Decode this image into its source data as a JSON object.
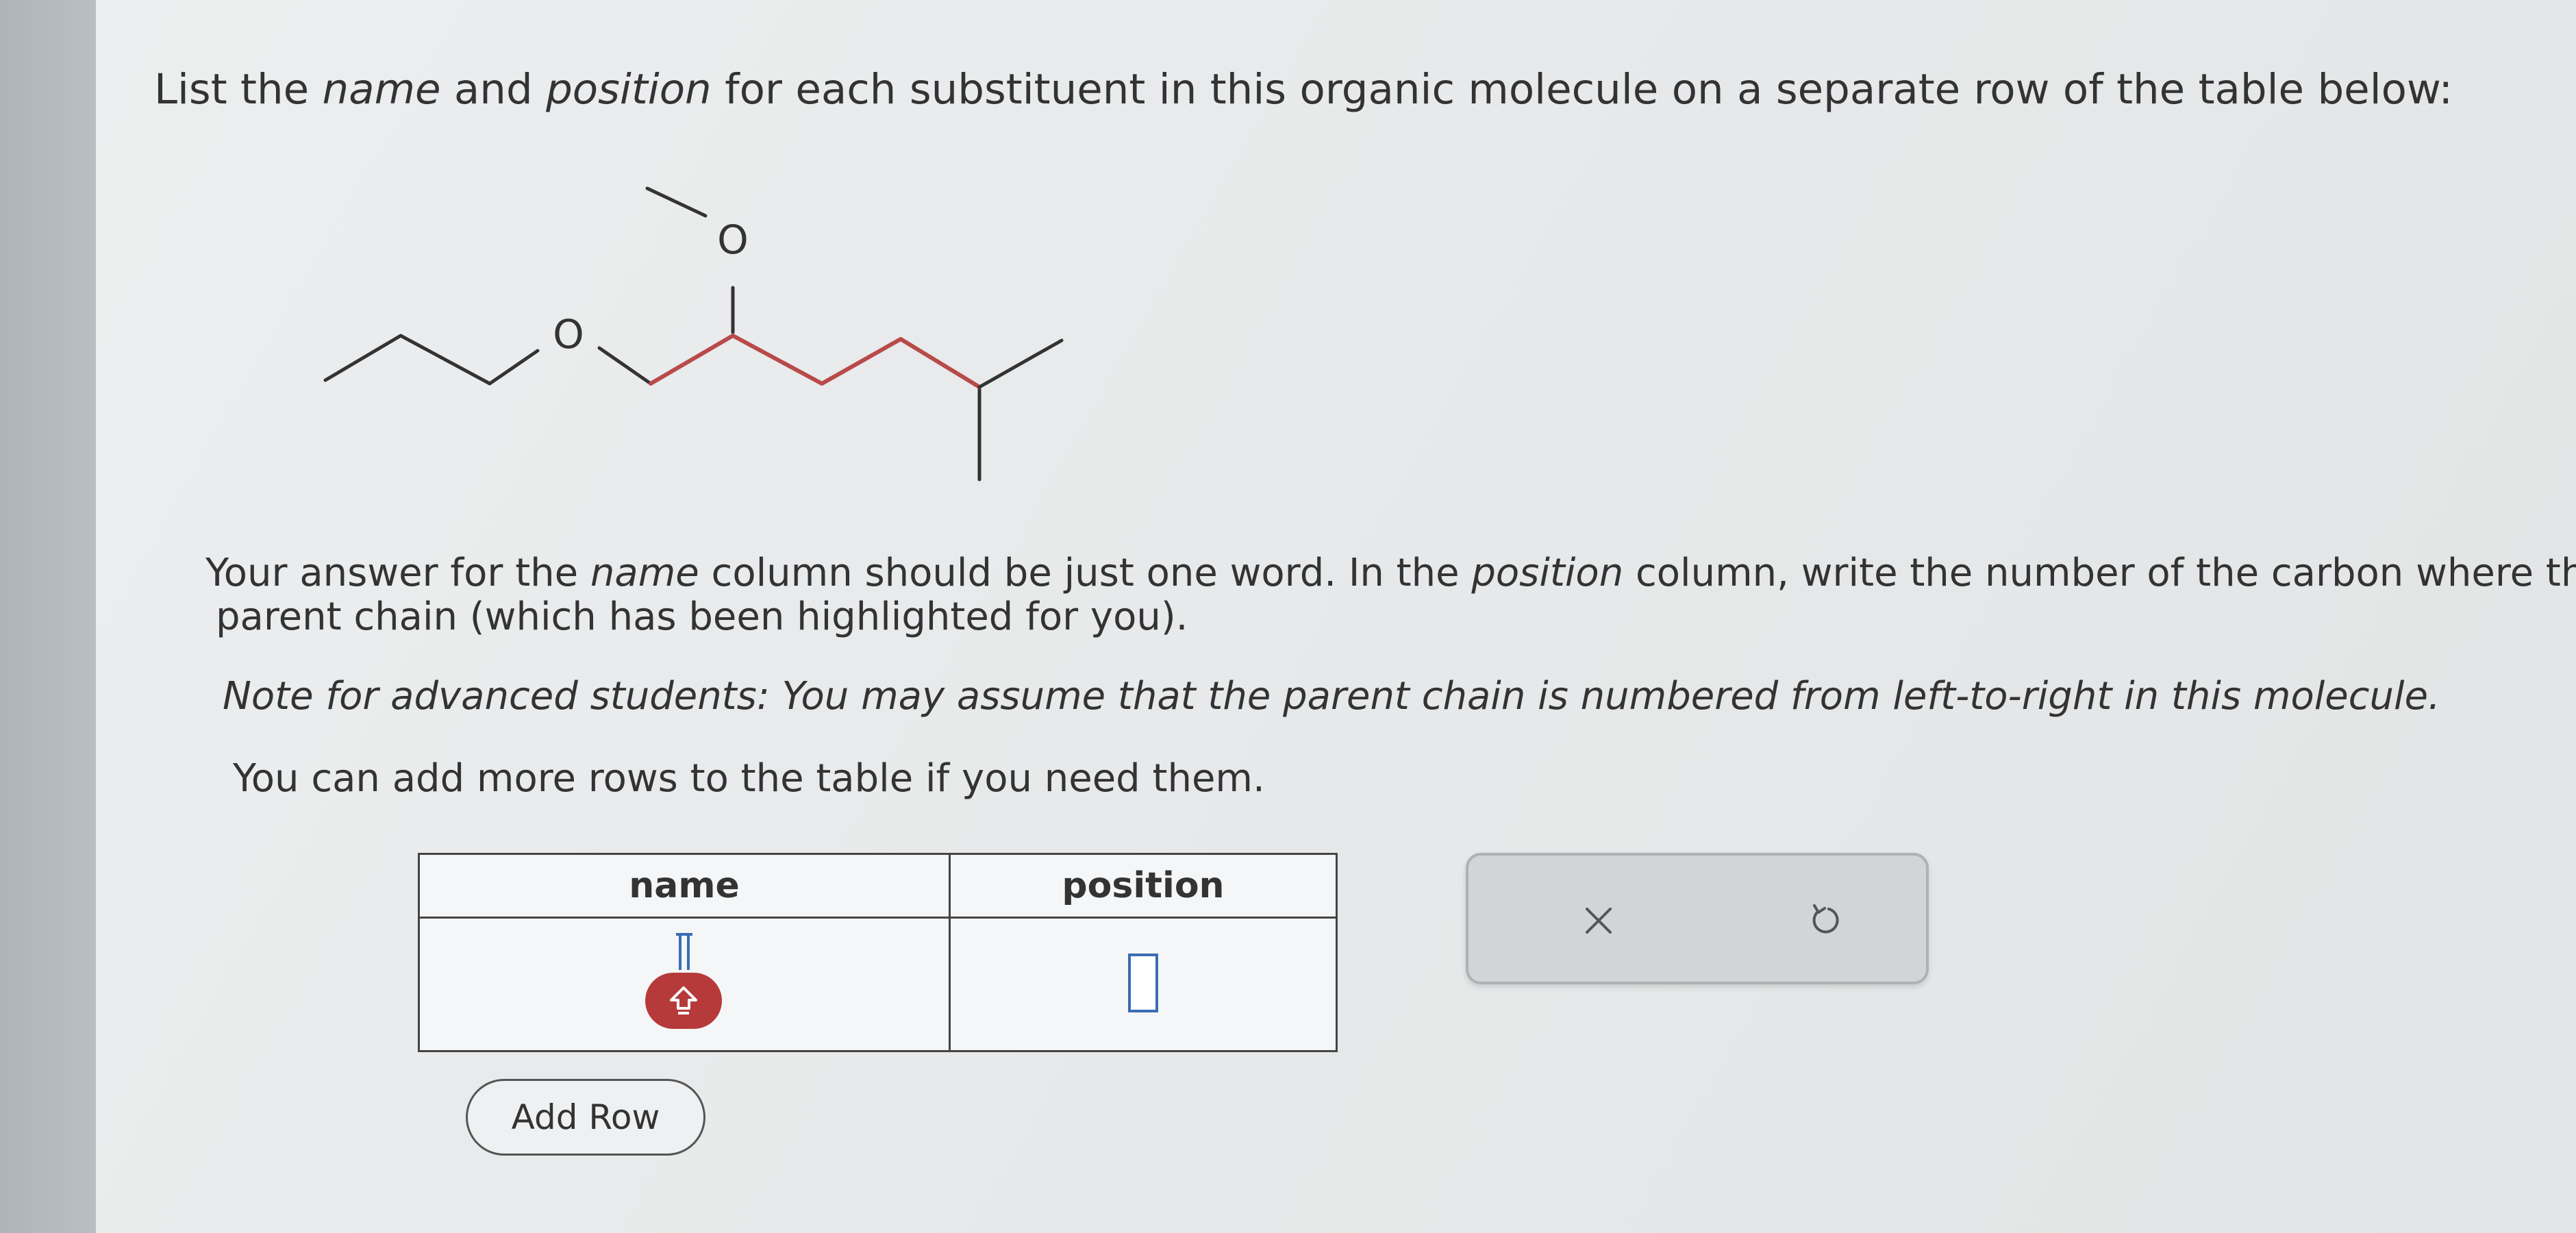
{
  "question": {
    "prefix": "List the ",
    "em1": "name",
    "middle": " and ",
    "em2": "position",
    "suffix": " for each substituent in this organic molecule on a separate row of the table below:"
  },
  "molecule": {
    "oxygen_label_top": "O",
    "oxygen_label_left": "O",
    "highlight_color": "#b84a4a"
  },
  "instructions": {
    "p1_a": "Your answer for the ",
    "p1_em1": "name",
    "p1_b": " column should be just one word. In the ",
    "p1_em2": "position",
    "p1_c": " column, write the number of the carbon where the",
    "p1_line2": "parent chain (which has been highlighted for you).",
    "note_em": "Note for advanced students:",
    "note_rest": " You may assume that the parent chain is numbered from left-to-right in this molecule.",
    "p3": "You can add more rows to the table if you need them."
  },
  "table": {
    "headers": [
      "name",
      "position"
    ],
    "rows": [
      {
        "name": "",
        "position": ""
      }
    ]
  },
  "buttons": {
    "add_row": "Add Row"
  },
  "icons": {
    "keyboard": "keyboard-toggle-icon",
    "clear": "close-icon",
    "undo": "undo-icon"
  },
  "colors": {
    "keyboard_button": "#b63a3a",
    "input_border": "#3a6db3"
  }
}
